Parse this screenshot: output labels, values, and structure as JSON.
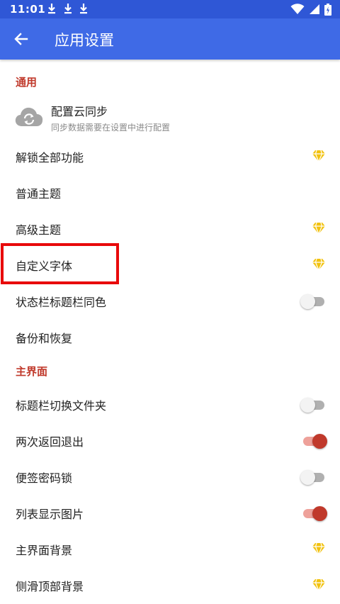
{
  "status_bar": {
    "time": "11:01",
    "icons": [
      "download-icon",
      "download-icon",
      "download-icon",
      "wifi-icon",
      "signal-icon",
      "battery-icon"
    ]
  },
  "app_bar": {
    "back_icon": "arrow-left-icon",
    "title": "应用设置"
  },
  "sections": {
    "general": {
      "header": "通用",
      "cloud_sync": {
        "title": "配置云同步",
        "subtitle": "同步数据需要在设置中进行配置",
        "icon": "cloud-sync-icon"
      },
      "items": [
        {
          "label": "解锁全部功能",
          "trailing": "diamond-icon"
        },
        {
          "label": "普通主题",
          "trailing": "none"
        },
        {
          "label": "高级主题",
          "trailing": "diamond-icon"
        },
        {
          "label": "自定义字体",
          "trailing": "diamond-icon"
        },
        {
          "label": "状态栏标题栏同色",
          "trailing": "toggle",
          "checked": false
        },
        {
          "label": "备份和恢复",
          "trailing": "none"
        }
      ]
    },
    "main_screen": {
      "header": "主界面",
      "items": [
        {
          "label": "标题栏切换文件夹",
          "trailing": "toggle",
          "checked": false
        },
        {
          "label": "两次返回退出",
          "trailing": "toggle",
          "checked": true
        },
        {
          "label": "便签密码锁",
          "trailing": "toggle",
          "checked": false
        },
        {
          "label": "列表显示图片",
          "trailing": "toggle",
          "checked": true
        },
        {
          "label": "主界面背景",
          "trailing": "diamond-icon"
        },
        {
          "label": "侧滑顶部背景",
          "trailing": "diamond-icon"
        }
      ]
    }
  },
  "colors": {
    "status_bar": "#2f57d6",
    "app_bar": "#3f6ae6",
    "section_header": "#c0392b",
    "toggle_on": "#c0392b",
    "diamond": "#f2c20f",
    "highlight_box": "#e8090a"
  }
}
